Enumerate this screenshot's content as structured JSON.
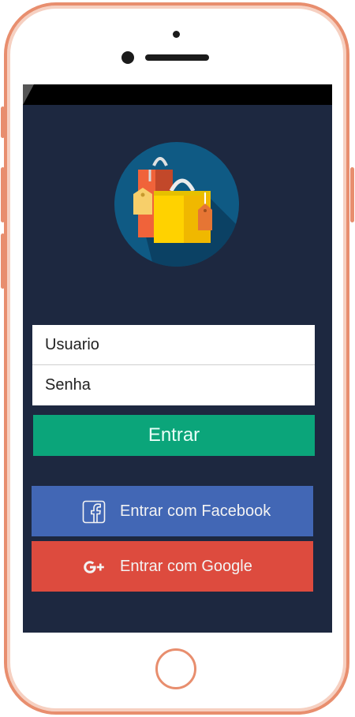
{
  "login": {
    "username_placeholder": "Usuario",
    "password_placeholder": "Senha",
    "submit_label": "Entrar"
  },
  "social": {
    "facebook_label": "Entrar com Facebook",
    "google_label": "Entrar com Google"
  },
  "icons": {
    "logo": "shopping-bags-icon",
    "facebook": "facebook-icon",
    "google": "google-plus-icon"
  },
  "colors": {
    "screen_background": "#1d2840",
    "submit_button": "#0ba57a",
    "facebook_button": "#4267b5",
    "google_button": "#dd4b3e",
    "phone_frame": "#e88e6e"
  }
}
